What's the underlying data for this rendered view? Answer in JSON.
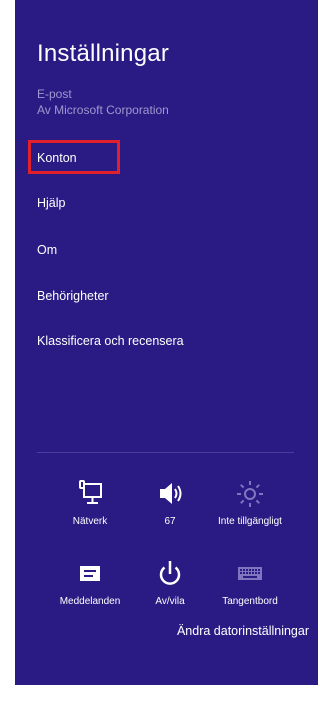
{
  "charm": {
    "title": "Inställningar",
    "app_name": "E-post",
    "app_publisher": "Av Microsoft Corporation",
    "menu": [
      {
        "label": "Konton"
      },
      {
        "label": "Hjälp"
      },
      {
        "label": "Om"
      },
      {
        "label": "Behörigheter"
      },
      {
        "label": "Klassificera och recensera"
      }
    ],
    "tiles": [
      {
        "label": "Nätverk",
        "icon": "network-icon"
      },
      {
        "label": "67",
        "icon": "volume-icon"
      },
      {
        "label": "Inte tillgängligt",
        "icon": "brightness-icon"
      },
      {
        "label": "Meddelanden",
        "icon": "notifications-icon"
      },
      {
        "label": "Av/vila",
        "icon": "power-icon"
      },
      {
        "label": "Tangentbord",
        "icon": "keyboard-icon"
      }
    ],
    "footer_link": "Ändra datorinställningar",
    "colors": {
      "background": "#2a1b84",
      "highlight": "#e0202a",
      "muted_text": "#9f97cf"
    }
  }
}
